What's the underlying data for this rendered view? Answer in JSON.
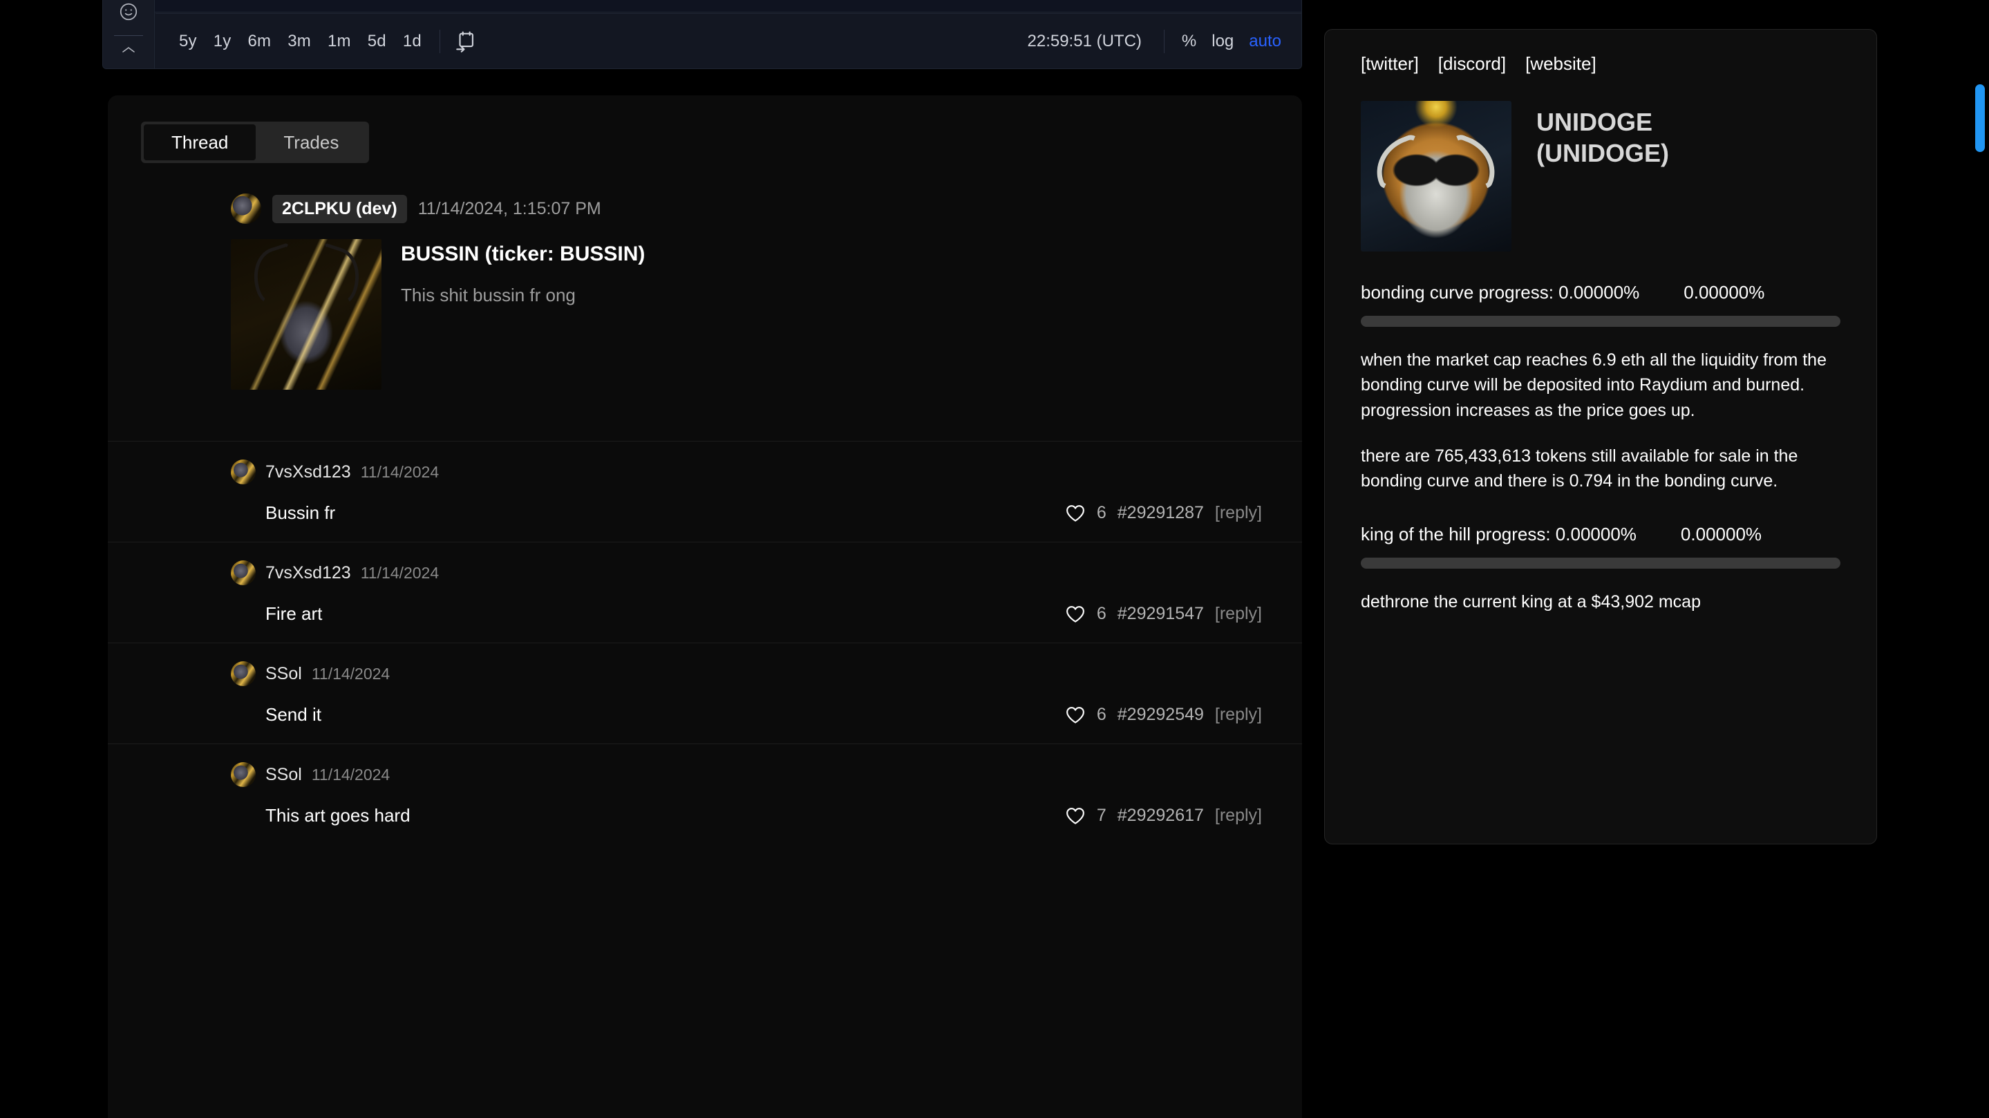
{
  "chart": {
    "timeframes": [
      "5y",
      "1y",
      "6m",
      "3m",
      "1m",
      "5d",
      "1d"
    ],
    "calendar_icon": "calendar-goto-icon",
    "smiley_icon": "smiley-face-icon",
    "chevron_icon": "chevron-up-icon",
    "clock": "22:59:51 (UTC)",
    "scale_options": [
      "%",
      "log",
      "auto"
    ],
    "active_scale": "auto"
  },
  "thread": {
    "tabs": [
      {
        "label": "Thread",
        "active": true
      },
      {
        "label": "Trades",
        "active": false
      }
    ],
    "post": {
      "author": "2CLPKU (dev)",
      "date": "11/14/2024, 1:15:07 PM",
      "title": "BUSSIN (ticker: BUSSIN)",
      "description": "This shit bussin fr ong",
      "image_alt": "bussin-goat-man-artwork"
    },
    "replies": [
      {
        "user": "7vsXsd123",
        "date": "11/14/2024",
        "text": "Bussin fr",
        "likes": "6",
        "id": "#29291287",
        "reply_label": "[reply]"
      },
      {
        "user": "7vsXsd123",
        "date": "11/14/2024",
        "text": "Fire art",
        "likes": "6",
        "id": "#29291547",
        "reply_label": "[reply]"
      },
      {
        "user": "SSol",
        "date": "11/14/2024",
        "text": "Send it",
        "likes": "6",
        "id": "#29292549",
        "reply_label": "[reply]"
      },
      {
        "user": "SSol",
        "date": "11/14/2024",
        "text": "This art goes hard",
        "likes": "7",
        "id": "#29292617",
        "reply_label": "[reply]"
      }
    ]
  },
  "token_panel": {
    "links": [
      "[twitter]",
      "[discord]",
      "[website]"
    ],
    "name": "UNIDOGE",
    "ticker_line": "(UNIDOGE)",
    "image_alt": "unidoge-goat-coin-logo",
    "bonding_curve": {
      "label": "bonding curve progress: 0.00000%",
      "percent_right": "0.00000%",
      "fill_percent": 0,
      "note_1": "when the market cap reaches 6.9 eth all the liquidity from the bonding curve will be deposited into Raydium and burned. progression increases as the price goes up.",
      "note_2": "there are 765,433,613 tokens still available for sale in the bonding curve and there is 0.794 in the bonding curve."
    },
    "king_of_hill": {
      "label": "king of the hill progress: 0.00000%",
      "percent_right": "0.00000%",
      "fill_percent": 0,
      "note": "dethrone the current king at a $43,902 mcap"
    }
  },
  "colors": {
    "accent_blue": "#2962ff",
    "scrollbar": "#2196f3",
    "panel_bg": "#0e0e0e",
    "chart_bg": "#131722"
  }
}
